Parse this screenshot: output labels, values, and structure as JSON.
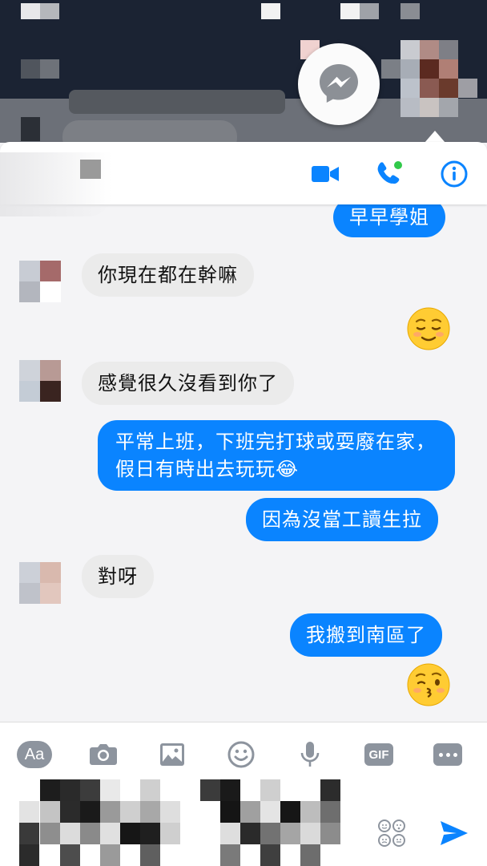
{
  "background": {
    "color": "#1b2333",
    "chathead_icon": "messenger-icon"
  },
  "header": {
    "icons": [
      "video-camera-icon",
      "phone-call-icon",
      "info-icon"
    ],
    "accent": "#0a84ff",
    "online_dot": "#31c94a"
  },
  "messages": [
    {
      "side": "out",
      "text": "早早學姐"
    },
    {
      "side": "in",
      "text": "你現在都在幹嘛"
    },
    {
      "side": "out",
      "emoji": "relieved-face-emoji"
    },
    {
      "side": "in",
      "text": "感覺很久沒看到你了"
    },
    {
      "side": "out",
      "text": "平常上班，下班完打球或耍廢在家，假日有時出去玩玩😂"
    },
    {
      "side": "out",
      "text": "因為沒當工讀生拉"
    },
    {
      "side": "in",
      "text": "對呀"
    },
    {
      "side": "out",
      "text": "我搬到南區了"
    },
    {
      "side": "out",
      "emoji": "kissing-face-emoji"
    }
  ],
  "toolbar": {
    "aa_label": "Aa",
    "gif_label": "GIF",
    "icons": [
      "camera-icon",
      "image-icon",
      "emoji-icon",
      "microphone-icon",
      "more-icon",
      "sticker-icon",
      "send-icon"
    ]
  },
  "colors": {
    "incoming_bubble": "#ebebeb",
    "outgoing_bubble": "#0a84ff",
    "toolbar_icon": "#8d949e",
    "send": "#0a84ff"
  }
}
